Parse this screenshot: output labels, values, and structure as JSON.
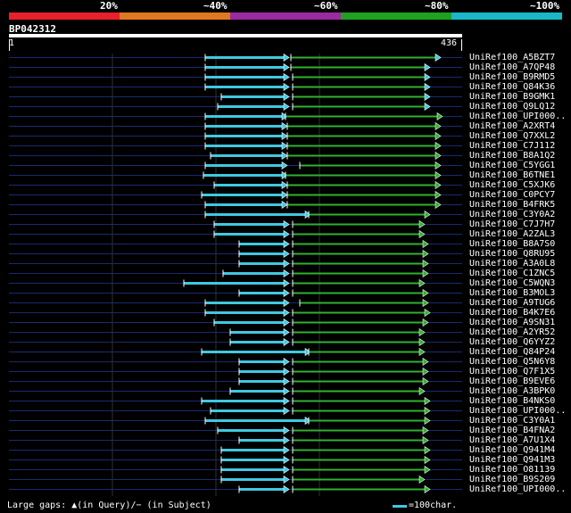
{
  "legend": {
    "segments": [
      {
        "label": "20%",
        "color": "#e8202a"
      },
      {
        "label": "~40%",
        "color": "#e07820"
      },
      {
        "label": "~60%",
        "color": "#9a2aa0"
      },
      {
        "label": "~80%",
        "color": "#20a020"
      },
      {
        "label": "~100%",
        "color": "#18b8c8"
      }
    ]
  },
  "query": {
    "name": "BP042312",
    "start": "1",
    "end": "436"
  },
  "colors": {
    "cyan": "#40c8e0",
    "green": "#30b030",
    "navy": "#1a2a70",
    "grid": "#303030"
  },
  "hits": [
    "UniRef100_A5BZT7",
    "UniRef100_A7QP48",
    "UniRef100_B9RMD5",
    "UniRef100_Q84K36",
    "UniRef100_B9GMK1",
    "UniRef100_Q9LQ12",
    "UniRef100_UPI000..",
    "UniRef100_A2XRT4",
    "UniRef100_Q7XXL2",
    "UniRef100_C7J112",
    "UniRef100_B8A1Q2",
    "UniRef100_C5YGG1",
    "UniRef100_B6TNE1",
    "UniRef100_C5XJK6",
    "UniRef100_C0PCY7",
    "UniRef100_B4FRK5",
    "UniRef100_C3Y0A2",
    "UniRef100_C7J7H7",
    "UniRef100_A2ZAL3",
    "UniRef100_B8A7S0",
    "UniRef100_Q8RU95",
    "UniRef100_A3A0L8",
    "UniRef100_C1ZNC5",
    "UniRef100_C5WQN3",
    "UniRef100_B3MOL3",
    "UniRef100_A9TUG6",
    "UniRef100_B4K7E6",
    "UniRef100_A9SN31",
    "UniRef100_A2YR52",
    "UniRef100_Q6YYZ2",
    "UniRef100_Q84P24",
    "UniRef100_Q5N6Y8",
    "UniRef100_Q7F1X5",
    "UniRef100_B9EVE6",
    "UniRef100_A3BPK0",
    "UniRef100_B4NKS0",
    "UniRef100_UPI000..",
    "UniRef100_C3Y0A1",
    "UniRef100_B4FNA2",
    "UniRef100_A7U1X4",
    "UniRef100_Q941M4",
    "UniRef100_Q941M3",
    "UniRef100_O81139",
    "UniRef100_B9S209",
    "UniRef100_UPI000.."
  ],
  "footer": "Large gaps: ▲(in Query)/− (in Subject)",
  "scale_label": "=100char."
}
